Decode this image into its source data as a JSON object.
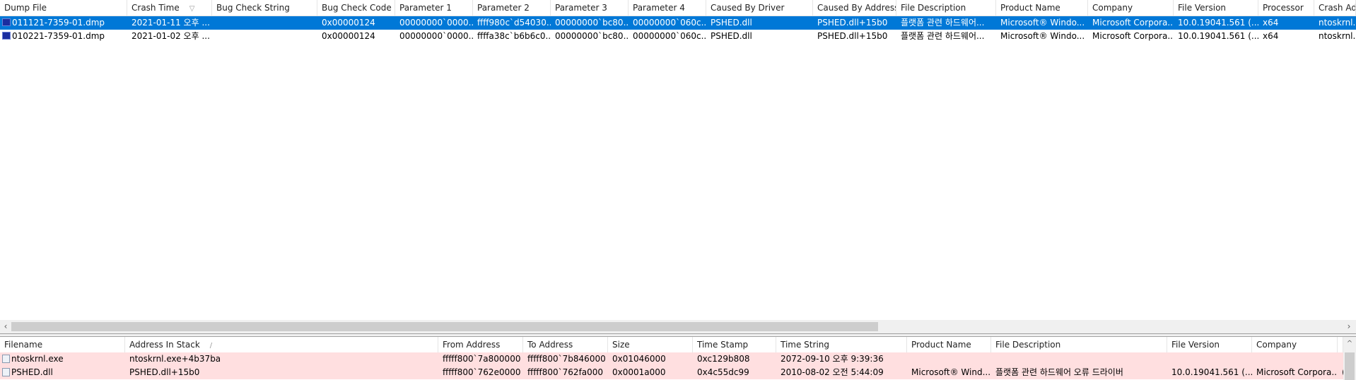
{
  "crash_list": {
    "columns": [
      "Dump File",
      "Crash Time",
      "Bug Check String",
      "Bug Check Code",
      "Parameter 1",
      "Parameter 2",
      "Parameter 3",
      "Parameter 4",
      "Caused By Driver",
      "Caused By Address",
      "File Description",
      "Product Name",
      "Company",
      "File Version",
      "Processor",
      "Crash Address"
    ],
    "sort_indicator": "▽",
    "rows": [
      {
        "selected": true,
        "icon": "monitor-icon",
        "cells": [
          "011121-7359-01.dmp",
          "2021-01-11 오후 ...",
          "",
          "0x00000124",
          "00000000`0000...",
          "ffff980c`d54030...",
          "00000000`bc80...",
          "00000000`060c...",
          "PSHED.dll",
          "PSHED.dll+15b0",
          "플랫폼 관련 하드웨어...",
          "Microsoft® Windo...",
          "Microsoft Corpora...",
          "10.0.19041.561 (...",
          "x64",
          "ntoskrnl.e"
        ]
      },
      {
        "selected": false,
        "icon": "monitor-icon",
        "cells": [
          "010221-7359-01.dmp",
          "2021-01-02 오후 ...",
          "",
          "0x00000124",
          "00000000`0000...",
          "ffffa38c`b6b6c0...",
          "00000000`bc80...",
          "00000000`060c...",
          "PSHED.dll",
          "PSHED.dll+15b0",
          "플랫폼 관련 하드웨어...",
          "Microsoft® Windo...",
          "Microsoft Corpora...",
          "10.0.19041.561 (...",
          "x64",
          "ntoskrnl.e"
        ]
      }
    ]
  },
  "scrollbar": {
    "left_arrow": "‹",
    "right_arrow": "›",
    "up_arrow": "^"
  },
  "driver_list": {
    "columns": [
      "Filename",
      "Address In Stack",
      "From Address",
      "To Address",
      "Size",
      "Time Stamp",
      "Time String",
      "Product Name",
      "File Description",
      "File Version",
      "Company",
      "I"
    ],
    "sort_indicator": "/",
    "rows": [
      {
        "icon": "dll-file-icon",
        "cells": [
          "ntoskrnl.exe",
          "ntoskrnl.exe+4b37ba",
          "fffff800`7a800000",
          "fffff800`7b846000",
          "0x01046000",
          "0xc129b808",
          "2072-09-10 오후 9:39:36",
          "",
          "",
          "",
          "",
          ""
        ]
      },
      {
        "icon": "dll-file-icon",
        "cells": [
          "PSHED.dll",
          "PSHED.dll+15b0",
          "fffff800`762e0000",
          "fffff800`762fa000",
          "0x0001a000",
          "0x4c55dc99",
          "2010-08-02 오전 5:44:09",
          "Microsoft® Wind...",
          "플랫폼 관련 하드웨어 오류 드라이버",
          "10.0.19041.561 (...",
          "Microsoft Corpora...",
          "("
        ]
      }
    ]
  },
  "colors": {
    "selection": "#0078d7",
    "highlight_row": "#ffdfe0"
  }
}
